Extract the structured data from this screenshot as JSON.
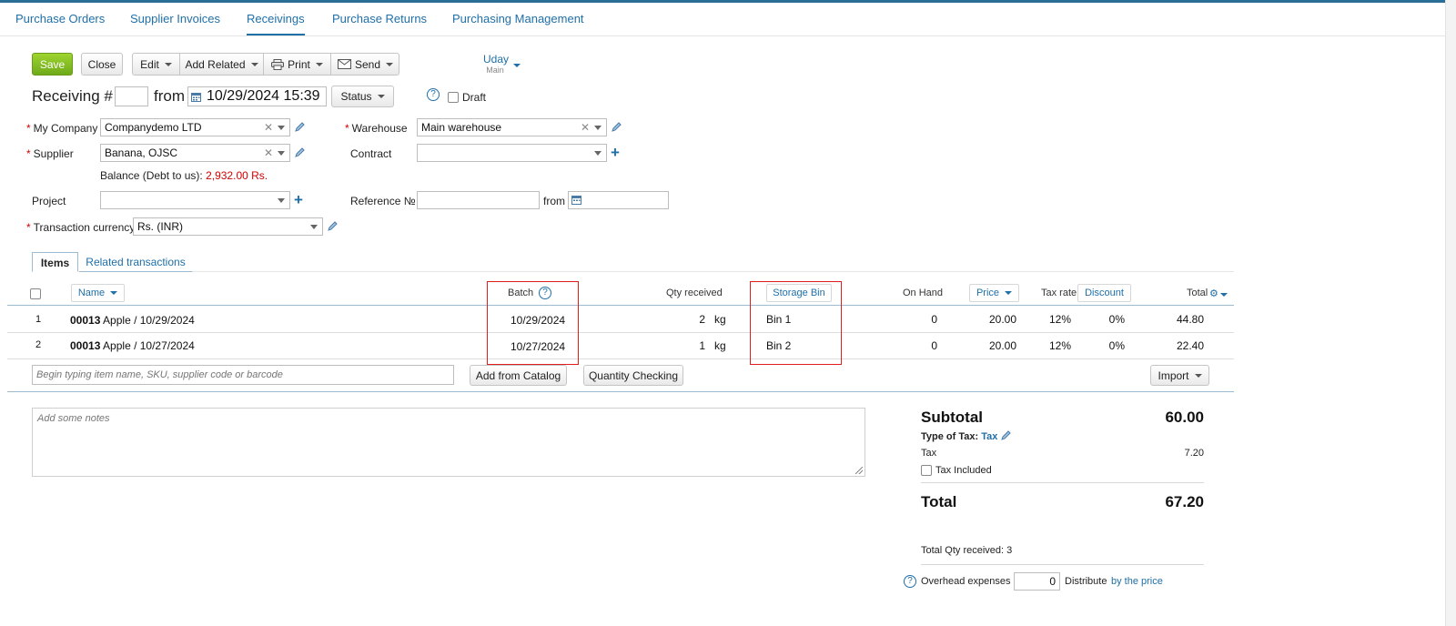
{
  "nav": {
    "tabs": [
      "Purchase Orders",
      "Supplier Invoices",
      "Receivings",
      "Purchase Returns",
      "Purchasing Management"
    ],
    "active": "Receivings"
  },
  "toolbar": {
    "save": "Save",
    "close": "Close",
    "edit": "Edit",
    "add_related": "Add Related",
    "print": "Print",
    "send": "Send",
    "user_name": "Uday",
    "user_sub": "Main"
  },
  "header": {
    "title": "Receiving #",
    "number": "",
    "from_label": "from",
    "datetime": "10/29/2024 15:39",
    "status": "Status",
    "draft": "Draft"
  },
  "form": {
    "my_company_label": "My Company",
    "my_company": "Companydemo LTD",
    "warehouse_label": "Warehouse",
    "warehouse": "Main warehouse",
    "supplier_label": "Supplier",
    "supplier": "Banana, OJSC",
    "contract_label": "Contract",
    "contract": "",
    "balance_label": "Balance (Debt to us):",
    "balance_value": "2,932.00 Rs.",
    "project_label": "Project",
    "project": "",
    "reference_label": "Reference №",
    "reference": "",
    "ref_from_label": "from",
    "ref_date": "",
    "currency_label": "Transaction currency",
    "currency": "Rs. (INR)"
  },
  "tabs": {
    "items": "Items",
    "related": "Related transactions"
  },
  "table": {
    "headers": {
      "name": "Name",
      "batch": "Batch",
      "qty": "Qty received",
      "storage_bin": "Storage Bin",
      "on_hand": "On Hand",
      "price": "Price",
      "tax_rate": "Tax rate",
      "discount": "Discount",
      "total": "Total"
    },
    "rows": [
      {
        "n": "1",
        "code": "00013",
        "name": "Apple / 10/29/2024",
        "batch": "10/29/2024",
        "qty": "2",
        "unit": "kg",
        "bin": "Bin 1",
        "on_hand": "0",
        "price": "20.00",
        "tax": "12%",
        "discount": "0%",
        "total": "44.80"
      },
      {
        "n": "2",
        "code": "00013",
        "name": "Apple / 10/27/2024",
        "batch": "10/27/2024",
        "qty": "1",
        "unit": "kg",
        "bin": "Bin 2",
        "on_hand": "0",
        "price": "20.00",
        "tax": "12%",
        "discount": "0%",
        "total": "22.40"
      }
    ],
    "search_placeholder": "Begin typing item name, SKU, supplier code or barcode",
    "add_from_catalog": "Add from Catalog",
    "quantity_checking": "Quantity Checking",
    "import": "Import"
  },
  "notes": {
    "placeholder": "Add some notes"
  },
  "summary": {
    "subtotal_label": "Subtotal",
    "subtotal": "60.00",
    "type_of_tax_label": "Type of Tax:",
    "type_of_tax": "Tax",
    "tax_label": "Tax",
    "tax": "7.20",
    "tax_included": "Tax Included",
    "total_label": "Total",
    "total": "67.20",
    "total_qty": "Total Qty received: 3",
    "overhead_label": "Overhead expenses",
    "overhead_value": "0",
    "distribute_label": "Distribute",
    "distribute_link": "by the price"
  },
  "colors": {
    "accent": "#1f6fa8",
    "save": "#7fbf22",
    "highlight": "#e11d1d",
    "balance": "#d40000"
  }
}
